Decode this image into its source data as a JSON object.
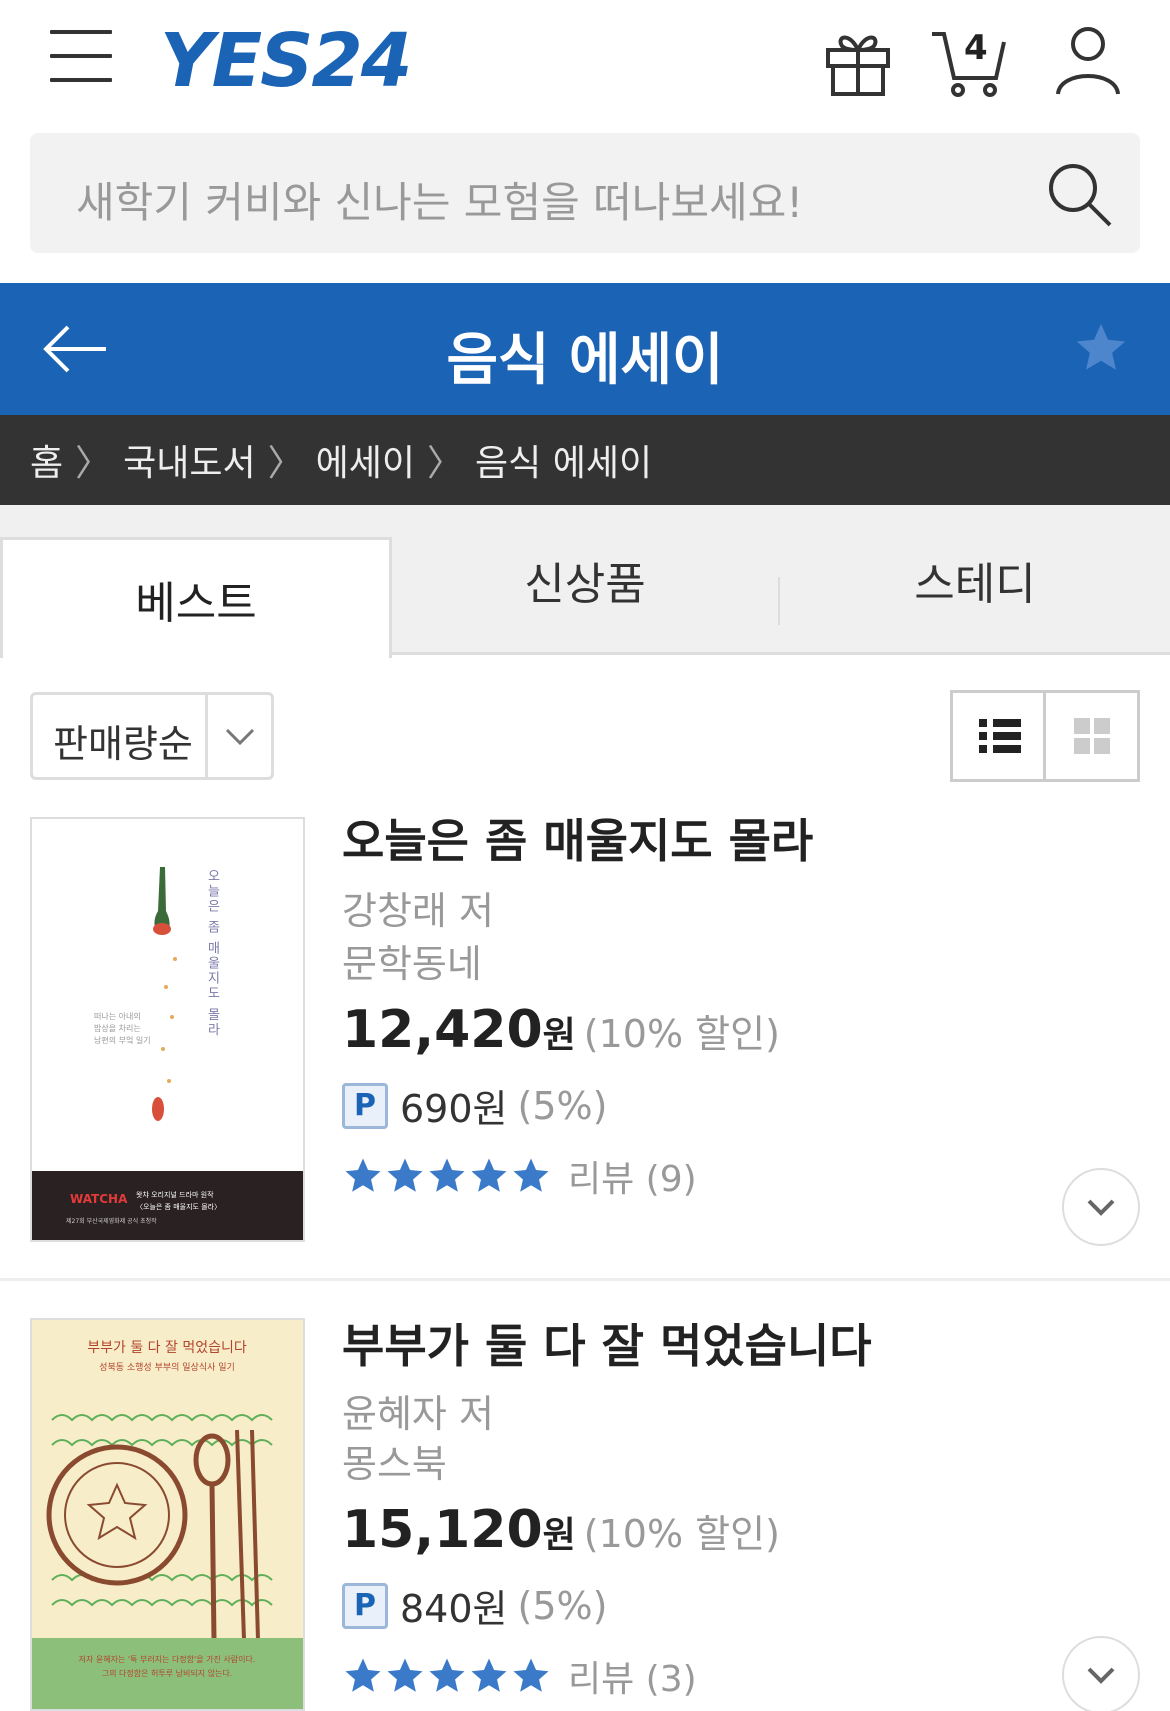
{
  "header": {
    "logo": "YES24",
    "cart_count": "4"
  },
  "search": {
    "placeholder": "새학기 커비와 신나는 모험을 떠나보세요!"
  },
  "titlebar": {
    "title": "음식 에세이"
  },
  "breadcrumb": [
    "홈",
    "국내도서",
    "에세이",
    "음식 에세이"
  ],
  "tabs": [
    {
      "label": "베스트",
      "active": true
    },
    {
      "label": "신상품",
      "active": false
    },
    {
      "label": "스테디",
      "active": false
    }
  ],
  "sort": {
    "selected": "판매량순"
  },
  "products": [
    {
      "title": "오늘은 좀 매울지도 몰라",
      "author": "강창래 저",
      "publisher": "문학동네",
      "price": "12,420",
      "won": "원",
      "discount": "(10% 할인)",
      "point_badge": "P",
      "point": "690원",
      "point_rate": "(5%)",
      "rating": 5,
      "review": "리뷰 (9)",
      "cover_title": "오늘은 좀 매울지도 몰라",
      "cover_banner": "WATCHA"
    },
    {
      "title": "부부가 둘 다 잘 먹었습니다",
      "author": "윤혜자 저",
      "publisher": "몽스북",
      "price": "15,120",
      "won": "원",
      "discount": "(10% 할인)",
      "point_badge": "P",
      "point": "840원",
      "point_rate": "(5%)",
      "rating": 5,
      "review": "리뷰 (3)",
      "cover_title": "부부가 둘 다 잘 먹었습니다"
    }
  ],
  "colors": {
    "brand": "#1a63b5",
    "breadcrumb_bg": "#333333",
    "star": "#3a7ac9"
  }
}
